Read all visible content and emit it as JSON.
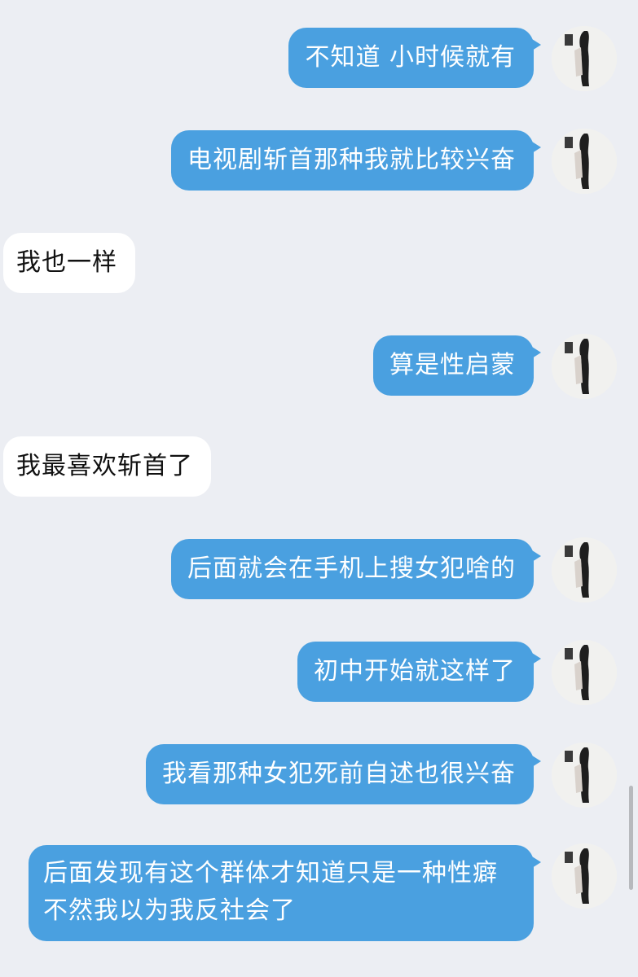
{
  "messages": [
    {
      "side": "sent",
      "text": "不知道 小时候就有"
    },
    {
      "side": "sent",
      "text": "电视剧斩首那种我就比较兴奋"
    },
    {
      "side": "received",
      "text": "我也一样"
    },
    {
      "side": "sent",
      "text": "算是性启蒙"
    },
    {
      "side": "received",
      "text": "我最喜欢斩首了"
    },
    {
      "side": "sent",
      "text": "后面就会在手机上搜女犯啥的"
    },
    {
      "side": "sent",
      "text": "初中开始就这样了"
    },
    {
      "side": "sent",
      "text": "我看那种女犯死前自述也很兴奋"
    },
    {
      "side": "sent",
      "text": "后面发现有这个群体才知道只是一种性癖 不然我以为我反社会了"
    }
  ],
  "colors": {
    "background": "#eceef3",
    "sent_bubble": "#4aa0e0",
    "sent_text": "#ffffff",
    "received_bubble": "#ffffff",
    "received_text": "#111111"
  },
  "icons": {
    "avatar": "user-avatar-photo"
  }
}
